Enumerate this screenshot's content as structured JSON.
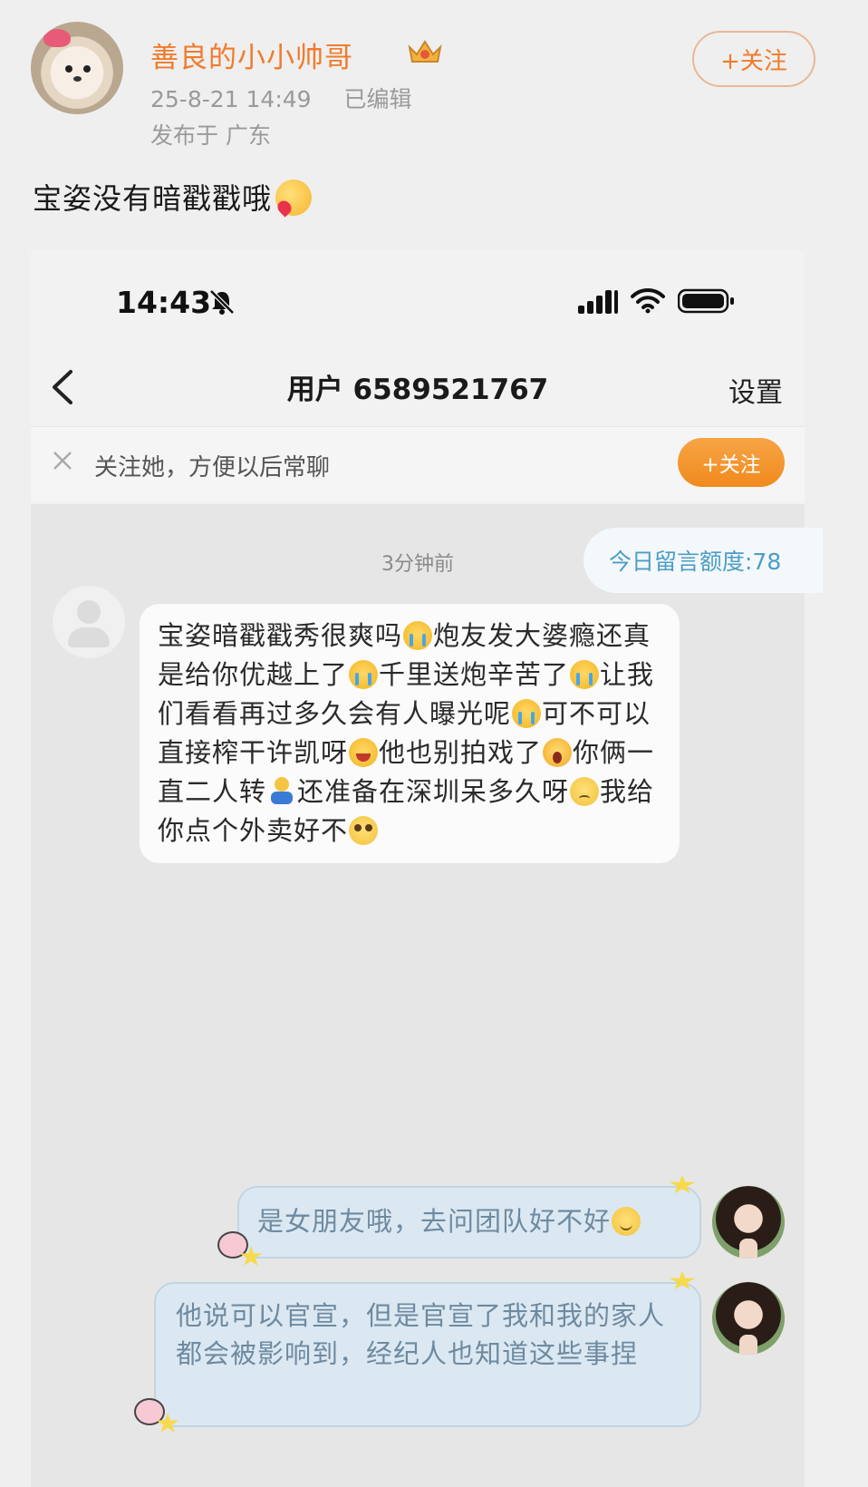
{
  "post": {
    "author_name": "善良的小小帅哥",
    "timestamp": "25-8-21 14:49",
    "edited_label": "已编辑",
    "location": "发布于 广东",
    "follow_label": "+关注",
    "text": "宝姿没有暗戳戳哦",
    "icons": [
      "crown-badge-icon",
      "heart-face-emoji"
    ]
  },
  "screenshot": {
    "status_bar": {
      "time": "14:43",
      "icons": [
        "bell-off-icon",
        "signal-icon",
        "wifi-icon",
        "battery-icon"
      ]
    },
    "nav": {
      "title": "用户 6589521767",
      "settings_label": "设置"
    },
    "follow_banner": {
      "text": "关注她，方便以后常聊",
      "button_label": "+关注"
    },
    "chat": {
      "time_divider": "3分钟前",
      "quota_text": "今日留言额度:78",
      "incoming": {
        "segments": [
          {
            "text": "宝姿暗戳戳秀很爽吗",
            "emoji": "cry"
          },
          {
            "text": "炮友发大婆瘾还真是给你优越上了",
            "emoji": "cry"
          },
          {
            "text": "千里送炮辛苦了",
            "emoji": "cry"
          },
          {
            "text": "让我们看看再过多久会有人曝光呢",
            "emoji": "cry"
          },
          {
            "text": "可不可以直接榨干许凯呀",
            "emoji": "laugh"
          },
          {
            "text": "他也别拍戏了",
            "emoji": "scream"
          },
          {
            "text": "你俩一直二人转",
            "emoji": "figure"
          },
          {
            "text": "还准备在深圳呆多久呀",
            "emoji": "sad"
          },
          {
            "text": "我给你点个外卖好不",
            "emoji": "plead"
          }
        ]
      },
      "outgoing": [
        {
          "text": "是女朋友哦，去问团队好不好",
          "emoji": "smile"
        },
        {
          "text": "他说可以官宣，但是官宣了我和我的家人都会被影响到，经纪人也知道这些事捏",
          "emoji": ""
        }
      ]
    }
  },
  "colors": {
    "brand_orange": "#f07b2c",
    "quota_blue": "#4a9ec7",
    "outgoing_bubble": "#dbe8f2"
  }
}
